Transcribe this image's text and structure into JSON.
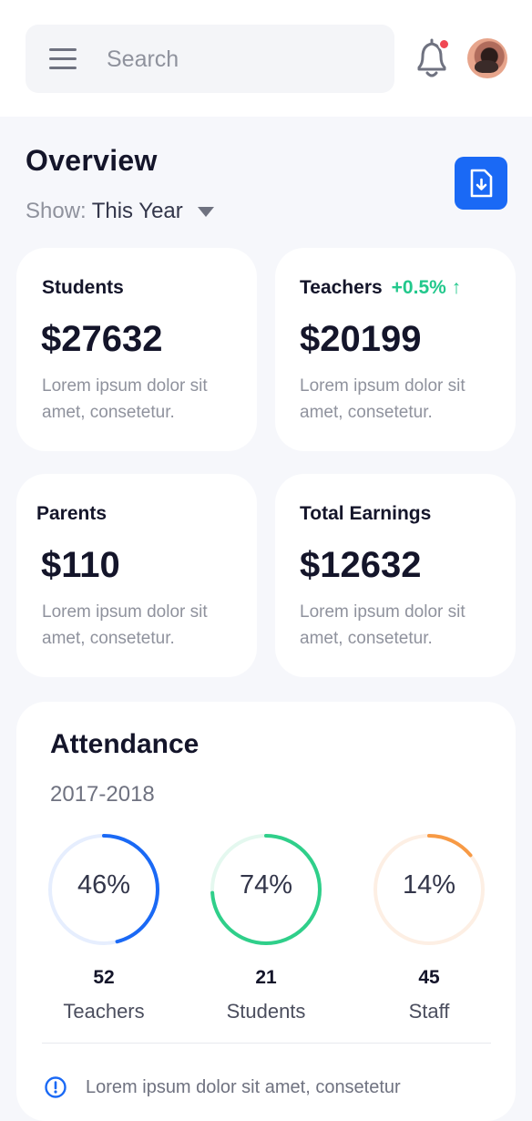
{
  "header": {
    "search_placeholder": "Search",
    "icons": {
      "menu": "menu-icon",
      "notifications": "bell-icon",
      "avatar": "user-avatar"
    },
    "notification_dot_color": "#f04752"
  },
  "overview": {
    "title": "Overview",
    "show_label": "Show:",
    "show_value": "This Year",
    "download_icon": "file-download-icon",
    "accent_color": "#1a69f5"
  },
  "stats": [
    {
      "title": "Students",
      "trend": "",
      "value": "$27632",
      "desc": "Lorem ipsum dolor sit amet, consetetur."
    },
    {
      "title": "Teachers",
      "trend": "+0.5% ↑",
      "value": "$20199",
      "desc": "Lorem ipsum dolor sit amet, consetetur."
    },
    {
      "title": "Parents",
      "trend": "",
      "value": "$110",
      "desc": "Lorem ipsum dolor sit amet, consetetur."
    },
    {
      "title": "Total Earnings",
      "trend": "",
      "value": "$12632",
      "desc": "Lorem ipsum dolor sit amet, consetetur."
    }
  ],
  "attendance": {
    "title": "Attendance",
    "year": "2017-2018",
    "gauges": [
      {
        "percent_label": "46%",
        "percent": 46,
        "count": "52",
        "label": "Teachers",
        "color": "#1a69f5",
        "track_color": "#e6eefe"
      },
      {
        "percent_label": "74%",
        "percent": 74,
        "count": "21",
        "label": "Students",
        "color": "#2fcf8a",
        "track_color": "#e4f8ef"
      },
      {
        "percent_label": "14%",
        "percent": 14,
        "count": "45",
        "label": "Staff",
        "color": "#f79a45",
        "track_color": "#fdefe4"
      }
    ],
    "note": "Lorem ipsum dolor sit amet, consetetur",
    "note_icon": "info-icon"
  }
}
